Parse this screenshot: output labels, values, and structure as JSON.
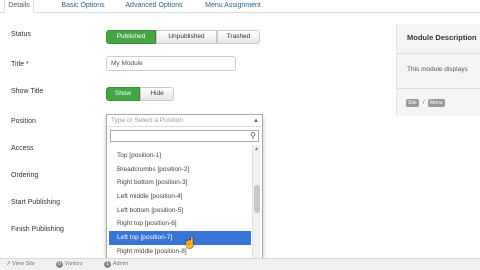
{
  "tabs": [
    {
      "label": "Details",
      "active": true
    },
    {
      "label": "Basic Options"
    },
    {
      "label": "Advanced Options"
    },
    {
      "label": "Menu Assignment"
    }
  ],
  "form": {
    "status_label": "Status",
    "status_buttons": [
      "Published",
      "Unpublished",
      "Trashed"
    ],
    "status_selected": "Published",
    "title_label": "Title *",
    "title_value": "My Module",
    "show_title_label": "Show Title",
    "show_title_buttons": [
      "Show",
      "Hide"
    ],
    "show_title_selected": "Show",
    "position_label": "Position",
    "access_label": "Access",
    "ordering_label": "Ordering",
    "start_publishing_label": "Start Publishing",
    "finish_publishing_label": "Finish Publishing"
  },
  "position_dropdown": {
    "placeholder": "Type or Select a Position",
    "options": [
      "Top [position-1]",
      "Breadcrumbs [position-2]",
      "Right bottom [position-3]",
      "Left middle [position-4]",
      "Left bottom [position-5]",
      "Right top [position-6]",
      "Left top [position-7]",
      "Right middle [position-8]"
    ],
    "highlighted": "Left top [position-7]"
  },
  "right_panel": {
    "title": "Module Description",
    "description": "This module displays",
    "badges": [
      "Site",
      "Menu"
    ],
    "badge_separator": "/"
  },
  "footer": {
    "view_site": "View Site",
    "visitors_count": "0",
    "visitors": "Visitors",
    "admin_count": "1",
    "admin": "Admin"
  },
  "colors": {
    "accent_green": "#46a546",
    "highlight_blue": "#3875d7",
    "link_blue": "#2a6496"
  }
}
